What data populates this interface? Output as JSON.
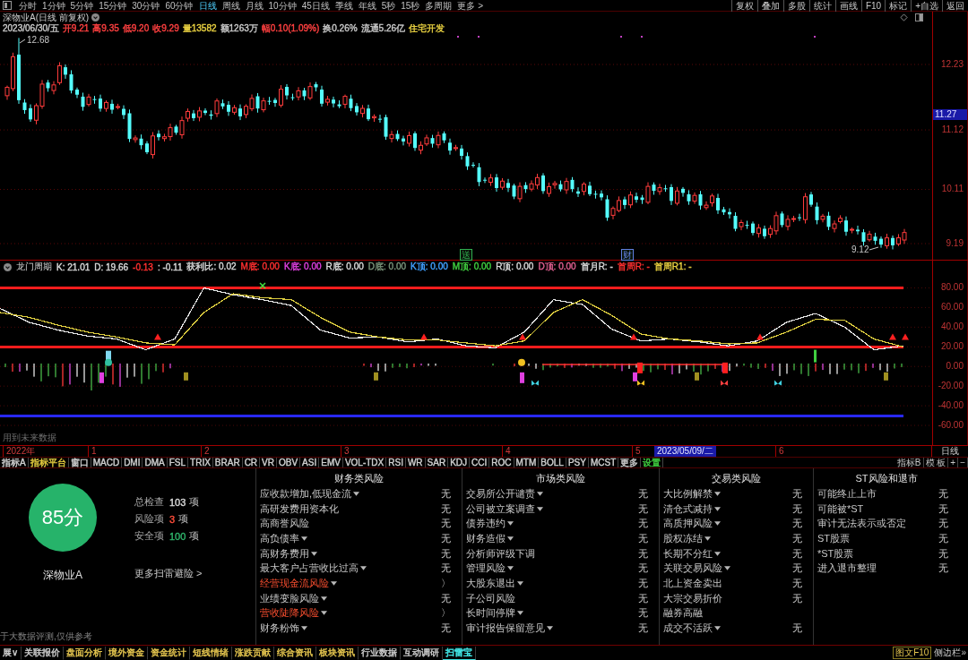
{
  "toolbar": {
    "periods": [
      {
        "label": "分时",
        "selected": false
      },
      {
        "label": "1分钟",
        "selected": false
      },
      {
        "label": "5分钟",
        "selected": false
      },
      {
        "label": "15分钟",
        "selected": false
      },
      {
        "label": "30分钟",
        "selected": false
      },
      {
        "label": "60分钟",
        "selected": false
      },
      {
        "label": "日线",
        "selected": true
      },
      {
        "label": "周线",
        "selected": false
      },
      {
        "label": "月线",
        "selected": false
      },
      {
        "label": "10分钟",
        "selected": false
      },
      {
        "label": "45日线",
        "selected": false
      },
      {
        "label": "季线",
        "selected": false
      },
      {
        "label": "年线",
        "selected": false
      },
      {
        "label": "5秒",
        "selected": false
      },
      {
        "label": "15秒",
        "selected": false
      },
      {
        "label": "多周期",
        "selected": false
      },
      {
        "label": "更多 >",
        "selected": false
      }
    ],
    "actions": [
      "复权",
      "叠加",
      "多股",
      "统计",
      "画线",
      "F10",
      "标记",
      "+自选",
      "返回"
    ]
  },
  "header": {
    "title": "深物业A(日线 前复权)",
    "quote": [
      {
        "text": "2023/06/30/五",
        "color": "#c8c8c8"
      },
      {
        "text": "开9.21",
        "color": "#ff4040"
      },
      {
        "text": "高9.35",
        "color": "#ff4040"
      },
      {
        "text": "低9.20",
        "color": "#ff4040"
      },
      {
        "text": "收9.29",
        "color": "#ff4040"
      },
      {
        "text": "量13582",
        "color": "#e8d040"
      },
      {
        "text": "额1263万",
        "color": "#c8c8c8"
      },
      {
        "text": "幅0.10(1.09%)",
        "color": "#ff4040"
      },
      {
        "text": "换0.26%",
        "color": "#c8c8c8"
      },
      {
        "text": "流通5.26亿",
        "color": "#c8c8c8"
      },
      {
        "text": "住宅开发",
        "color": "#e8d040"
      }
    ]
  },
  "main_chart": {
    "price_ticks": [
      "12.23",
      "11.12",
      "10.11",
      "9.19"
    ],
    "current_price": "11.27",
    "high_label": "12.68",
    "low_label": "9.12",
    "event_marks": [
      {
        "text": "送",
        "color": "#30b050"
      },
      {
        "text": "财",
        "color": "#6080e0"
      }
    ]
  },
  "indicator": {
    "name": "龙门周期",
    "readouts": [
      {
        "text": "K: 21.01",
        "color": "#d8d8d8"
      },
      {
        "text": "D: 19.66",
        "color": "#d8d8d8"
      },
      {
        "text": "-0.13",
        "color": "#ff3030"
      },
      {
        "text": ": -0.11",
        "color": "#d8d8d8"
      },
      {
        "text": "获利比: 0.02",
        "color": "#d8d8d8"
      },
      {
        "text": "M底: 0.00",
        "color": "#ff3030"
      },
      {
        "text": "K底: 0.00",
        "color": "#e040e0"
      },
      {
        "text": "R底: 0.00",
        "color": "#d8d8d8"
      },
      {
        "text": "D底: 0.00",
        "color": "#7a947a"
      },
      {
        "text": "K顶: 0.00",
        "color": "#40a0ff"
      },
      {
        "text": "M顶: 0.00",
        "color": "#40d040"
      },
      {
        "text": "R顶: 0.00",
        "color": "#d8d8d8"
      },
      {
        "text": "D顶: 0.00",
        "color": "#e06090"
      },
      {
        "text": "首月R: -",
        "color": "#d8d8d8"
      },
      {
        "text": "首周R: -",
        "color": "#ff3030"
      },
      {
        "text": "首周R1: -",
        "color": "#e8d040"
      }
    ],
    "chart_data": {
      "type": "line",
      "categories": [
        null,
        null,
        null,
        null,
        null,
        null,
        null,
        null,
        null,
        null,
        null,
        null,
        null,
        null,
        null,
        null,
        null,
        null,
        null,
        null,
        null,
        null,
        null,
        null,
        null,
        null,
        null,
        null,
        null,
        null,
        null,
        null
      ],
      "ylim": [
        -80,
        95
      ],
      "yticks": [
        {
          "value": 80,
          "label": "80.00"
        },
        {
          "value": 60,
          "label": "60.00"
        },
        {
          "value": 40,
          "label": "40.00"
        },
        {
          "value": 20,
          "label": "20.00"
        },
        {
          "value": 0,
          "label": "0.00"
        },
        {
          "value": -20,
          "label": "-20.00"
        },
        {
          "value": -40,
          "label": "-40.00"
        },
        {
          "value": -60,
          "label": "-60.00"
        }
      ],
      "grid": true,
      "series": [
        {
          "color": "#e8e8e8",
          "values": [
            59,
            45,
            37,
            31,
            28,
            17,
            28,
            80,
            73,
            68,
            62,
            37,
            29,
            30,
            25,
            28,
            21,
            19,
            35,
            68,
            63,
            38,
            26,
            28,
            25,
            21,
            26,
            45,
            54,
            40,
            17,
            21
          ]
        },
        {
          "color": "#e0d040",
          "values": [
            55,
            50,
            42,
            35,
            30,
            24,
            22,
            55,
            74,
            70,
            68,
            50,
            35,
            30,
            27,
            27,
            24,
            21,
            26,
            55,
            68,
            52,
            33,
            28,
            26,
            23,
            24,
            35,
            48,
            47,
            28,
            20
          ]
        },
        {
          "color": "#ff1c1c",
          "values": [
            80,
            80,
            80,
            80,
            80,
            80,
            80,
            80,
            80,
            80,
            80,
            80,
            80,
            80,
            80,
            80,
            80,
            80,
            80,
            80,
            80,
            80,
            80,
            80,
            80,
            80,
            80,
            80,
            80,
            80,
            80,
            80
          ]
        },
        {
          "color": "#ff1c1c",
          "values": [
            20,
            20,
            20,
            20,
            20,
            20,
            20,
            20,
            20,
            20,
            20,
            20,
            20,
            20,
            20,
            20,
            20,
            20,
            20,
            20,
            20,
            20,
            20,
            20,
            20,
            20,
            20,
            20,
            20,
            20,
            20,
            20
          ]
        },
        {
          "color": "#2828ff",
          "values": [
            -50,
            -50,
            -50,
            -50,
            -50,
            -50,
            -50,
            -50,
            -50,
            -50,
            -50,
            -50,
            -50,
            -50,
            -50,
            -50,
            -50,
            -50,
            -50,
            -50,
            -50,
            -50,
            -50,
            -50,
            -50,
            -50,
            -50,
            -50,
            -50,
            -50,
            -50,
            -50
          ]
        }
      ]
    },
    "note": "用到未来数据"
  },
  "time_axis": {
    "labels": [
      {
        "text": "2022年",
        "kind": "tick"
      },
      {
        "text": "1",
        "kind": "tick"
      },
      {
        "text": "2",
        "kind": "tick"
      },
      {
        "text": "3",
        "kind": "tick"
      },
      {
        "text": "4",
        "kind": "tick"
      },
      {
        "text": "5",
        "kind": "tick"
      },
      {
        "text": "2023/05/09/二",
        "kind": "cursor"
      },
      {
        "text": "6",
        "kind": "tick"
      }
    ],
    "period": "日线"
  },
  "indicator_tabs": {
    "left": [
      {
        "label": "指标A",
        "color": "#d0d0d0"
      },
      {
        "label": "指标平台",
        "color": "#e8d040"
      },
      {
        "label": "窗口",
        "color": "#d0d0d0"
      },
      {
        "label": "MACD",
        "color": "#d0d0d0"
      },
      {
        "label": "DMI",
        "color": "#d0d0d0"
      },
      {
        "label": "DMA",
        "color": "#d0d0d0"
      },
      {
        "label": "FSL",
        "color": "#d0d0d0"
      },
      {
        "label": "TRIX",
        "color": "#d0d0d0"
      },
      {
        "label": "BRAR",
        "color": "#d0d0d0"
      },
      {
        "label": "CR",
        "color": "#d0d0d0"
      },
      {
        "label": "VR",
        "color": "#d0d0d0"
      },
      {
        "label": "OBV",
        "color": "#d0d0d0"
      },
      {
        "label": "ASI",
        "color": "#d0d0d0"
      },
      {
        "label": "EMV",
        "color": "#d0d0d0"
      },
      {
        "label": "VOL-TDX",
        "color": "#d0d0d0"
      },
      {
        "label": "RSI",
        "color": "#d0d0d0"
      },
      {
        "label": "WR",
        "color": "#d0d0d0"
      },
      {
        "label": "SAR",
        "color": "#d0d0d0"
      },
      {
        "label": "KDJ",
        "color": "#d0d0d0"
      },
      {
        "label": "CCI",
        "color": "#d0d0d0"
      },
      {
        "label": "ROC",
        "color": "#d0d0d0"
      },
      {
        "label": "MTM",
        "color": "#d0d0d0"
      },
      {
        "label": "BOLL",
        "color": "#d0d0d0"
      },
      {
        "label": "PSY",
        "color": "#d0d0d0"
      },
      {
        "label": "MCST",
        "color": "#d0d0d0"
      },
      {
        "label": "更多",
        "color": "#d0d0d0"
      },
      {
        "label": "设置",
        "color": "#40d040"
      }
    ],
    "right": [
      "指标B",
      "模 板",
      "+",
      "−"
    ]
  },
  "risk": {
    "score": "85分",
    "stock": "深物业A",
    "stats": [
      {
        "label": "总检查",
        "value": "103",
        "unit": "项",
        "color": "#d8d8d8"
      },
      {
        "label": "风险项",
        "value": "3",
        "unit": "项",
        "color": "#ff4d3a"
      },
      {
        "label": "安全项",
        "value": "100",
        "unit": "项",
        "color": "#2fb36a"
      }
    ],
    "more_link": "更多扫雷避险 >",
    "disclaimer": "于大数据评测,仅供参考",
    "categories": [
      {
        "title": "财务类风险",
        "items": [
          {
            "label": "应收款增加,低现金流",
            "dropdown": true,
            "flagged": false,
            "status": "无"
          },
          {
            "label": "高研发费用资本化",
            "dropdown": false,
            "flagged": false,
            "status": "无"
          },
          {
            "label": "高商誉风险",
            "dropdown": false,
            "flagged": false,
            "status": "无"
          },
          {
            "label": "高负债率",
            "dropdown": true,
            "flagged": false,
            "status": "无"
          },
          {
            "label": "高财务费用",
            "dropdown": true,
            "flagged": false,
            "status": "无"
          },
          {
            "label": "最大客户占营收比过高",
            "dropdown": true,
            "flagged": false,
            "status": "无"
          },
          {
            "label": "经营现金流风险",
            "dropdown": true,
            "flagged": true,
            "status": "〉"
          },
          {
            "label": "业绩变脸风险",
            "dropdown": true,
            "flagged": false,
            "status": "无"
          },
          {
            "label": "营收陡降风险",
            "dropdown": true,
            "flagged": true,
            "status": "〉"
          },
          {
            "label": "财务粉饰",
            "dropdown": true,
            "flagged": false,
            "status": "无"
          }
        ]
      },
      {
        "title": "市场类风险",
        "items": [
          {
            "label": "交易所公开谴责",
            "dropdown": true,
            "flagged": false,
            "status": "无"
          },
          {
            "label": "公司被立案调查",
            "dropdown": true,
            "flagged": false,
            "status": "无"
          },
          {
            "label": "债券违约",
            "dropdown": true,
            "flagged": false,
            "status": "无"
          },
          {
            "label": "财务造假",
            "dropdown": true,
            "flagged": false,
            "status": "无"
          },
          {
            "label": "分析师评级下调",
            "dropdown": false,
            "flagged": false,
            "status": "无"
          },
          {
            "label": "管理风险",
            "dropdown": true,
            "flagged": false,
            "status": "无"
          },
          {
            "label": "大股东退出",
            "dropdown": true,
            "flagged": false,
            "status": "无"
          },
          {
            "label": "子公司风险",
            "dropdown": false,
            "flagged": false,
            "status": "无"
          },
          {
            "label": "长时间停牌",
            "dropdown": true,
            "flagged": false,
            "status": "无"
          },
          {
            "label": "审计报告保留意见",
            "dropdown": true,
            "flagged": false,
            "status": "无"
          }
        ]
      },
      {
        "title": "交易类风险",
        "items": [
          {
            "label": "大比例解禁",
            "dropdown": true,
            "flagged": false,
            "status": "无"
          },
          {
            "label": "清仓式减持",
            "dropdown": true,
            "flagged": false,
            "status": "无"
          },
          {
            "label": "高质押风险",
            "dropdown": true,
            "flagged": false,
            "status": "无"
          },
          {
            "label": "股权冻结",
            "dropdown": true,
            "flagged": false,
            "status": "无"
          },
          {
            "label": "长期不分红",
            "dropdown": true,
            "flagged": false,
            "status": "无"
          },
          {
            "label": "关联交易风险",
            "dropdown": true,
            "flagged": false,
            "status": "无"
          },
          {
            "label": "北上资金卖出",
            "dropdown": false,
            "flagged": false,
            "status": "无"
          },
          {
            "label": "大宗交易折价",
            "dropdown": false,
            "flagged": false,
            "status": "无"
          },
          {
            "label": "融券高融",
            "dropdown": false,
            "flagged": false
          },
          {
            "label": "成交不活跃",
            "dropdown": true,
            "flagged": false,
            "status": "无"
          }
        ]
      },
      {
        "title": "ST风险和退市",
        "items": [
          {
            "label": "可能终止上市",
            "dropdown": false,
            "flagged": false,
            "status": "无"
          },
          {
            "label": "可能被*ST",
            "dropdown": false,
            "flagged": false,
            "status": "无"
          },
          {
            "label": "审计无法表示或否定",
            "dropdown": false,
            "flagged": false,
            "status": "无"
          },
          {
            "label": "ST股票",
            "dropdown": false,
            "flagged": false,
            "status": "无"
          },
          {
            "label": "*ST股票",
            "dropdown": false,
            "flagged": false,
            "status": "无"
          },
          {
            "label": "进入退市整理",
            "dropdown": false,
            "flagged": false,
            "status": "无"
          }
        ]
      }
    ]
  },
  "bottom_bar": {
    "tabs": [
      {
        "label": "展∨",
        "selected": false,
        "color": "#d0d0d0"
      },
      {
        "label": "关联报价",
        "selected": false,
        "color": "#d0d0d0"
      },
      {
        "label": "盘面分析",
        "selected": false,
        "color": "#e8c850"
      },
      {
        "label": "境外资金",
        "selected": false,
        "color": "#e8c850"
      },
      {
        "label": "资金统计",
        "selected": false,
        "color": "#e8c850"
      },
      {
        "label": "短线情绪",
        "selected": false,
        "color": "#e8c850"
      },
      {
        "label": "涨跌贡献",
        "selected": false,
        "color": "#e8c850"
      },
      {
        "label": "综合资讯",
        "selected": false,
        "color": "#e8c850"
      },
      {
        "label": "板块资讯",
        "selected": false,
        "color": "#e8c850"
      },
      {
        "label": "行业数据",
        "selected": false,
        "color": "#d0d0d0"
      },
      {
        "label": "互动调研",
        "selected": false,
        "color": "#d0d0d0"
      },
      {
        "label": "扫雷宝",
        "selected": true,
        "color": "#40e0e0"
      }
    ],
    "f10": "图文F10",
    "sidebar": "侧边栏»"
  }
}
